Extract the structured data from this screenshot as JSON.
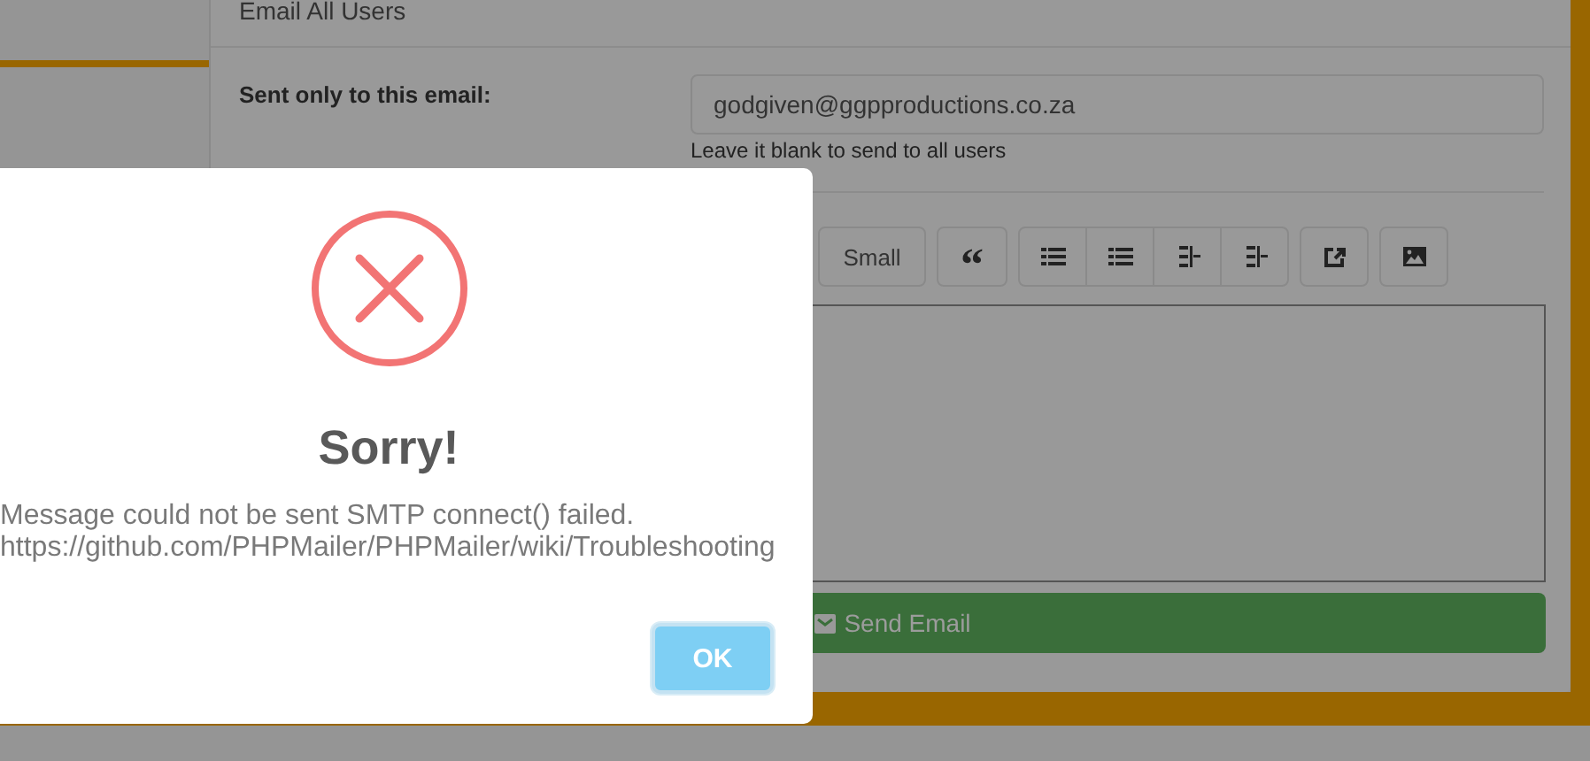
{
  "panel": {
    "title": "Email All Users",
    "email_label": "Sent only to this email:",
    "email_value": "godgiven@ggpproductions.co.za",
    "email_hint": "Leave it blank to send to all users",
    "toolbar": [
      {
        "kind": "text",
        "label": "Small"
      },
      {
        "kind": "quote",
        "label": "“"
      },
      {
        "kind": "group",
        "buttons": [
          {
            "kind": "bullets"
          },
          {
            "kind": "numbers"
          },
          {
            "kind": "outdent"
          },
          {
            "kind": "indent"
          }
        ]
      },
      {
        "kind": "share"
      },
      {
        "kind": "image"
      }
    ],
    "send_button": "Send Email"
  },
  "dialog": {
    "kind": "error",
    "title": "Sorry!",
    "message_lines": [
      "Message could not be sent SMTP connect() failed.",
      "https://github.com/PHPMailer/PHPMailer/wiki/Troubleshooting"
    ],
    "confirm_button": "OK"
  }
}
